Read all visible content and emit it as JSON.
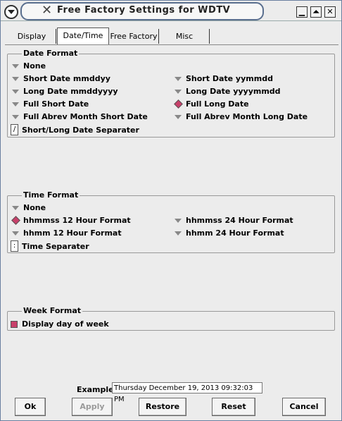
{
  "window": {
    "title": "Free Factory Settings for WDTV"
  },
  "tabs": [
    {
      "label": "Display"
    },
    {
      "label": "Date/Time",
      "active": true
    },
    {
      "label": "Free Factory"
    },
    {
      "label": "Misc"
    }
  ],
  "date_format": {
    "legend": "Date Format",
    "options": [
      {
        "label": "None",
        "selected": false
      },
      {
        "label": "Short Date mmddyy",
        "selected": false
      },
      {
        "label": "Short Date yymmdd",
        "selected": false
      },
      {
        "label": "Long Date mmddyyyy",
        "selected": false
      },
      {
        "label": "Long Date yyyymmdd",
        "selected": false
      },
      {
        "label": "Full Short Date",
        "selected": false
      },
      {
        "label": "Full Long Date",
        "selected": true
      },
      {
        "label": "Full Abrev Month Short Date",
        "selected": false
      },
      {
        "label": "Full  Abrev Month Long Date",
        "selected": false
      }
    ],
    "separator_value": "/",
    "separator_label": "Short/Long Date Separater"
  },
  "time_format": {
    "legend": "Time Format",
    "options": [
      {
        "label": "None",
        "selected": false
      },
      {
        "label": "hhmmss 12 Hour Format",
        "selected": true
      },
      {
        "label": "hhmmss 24 Hour Format",
        "selected": false
      },
      {
        "label": "hhmm 12 Hour Format",
        "selected": false
      },
      {
        "label": "hhmm 24 Hour Format",
        "selected": false
      }
    ],
    "separator_value": ":",
    "separator_label": "Time Separater"
  },
  "week_format": {
    "legend": "Week Format",
    "checkbox_label": "Display day of week",
    "checked": true
  },
  "example": {
    "label": "Example",
    "value": "Thursday December 19, 2013     09:32:03 PM"
  },
  "buttons": {
    "ok": "Ok",
    "apply": "Apply",
    "restore": "Restore",
    "reset": "Reset",
    "cancel": "Cancel"
  },
  "colors": {
    "selected_marker": "#c8406a",
    "title_border": "#5a6f8f"
  },
  "icons": [
    "window-menu-icon",
    "app-logo-icon",
    "minimize-icon",
    "maximize-icon",
    "close-icon",
    "radio-on-icon",
    "radio-off-icon"
  ]
}
